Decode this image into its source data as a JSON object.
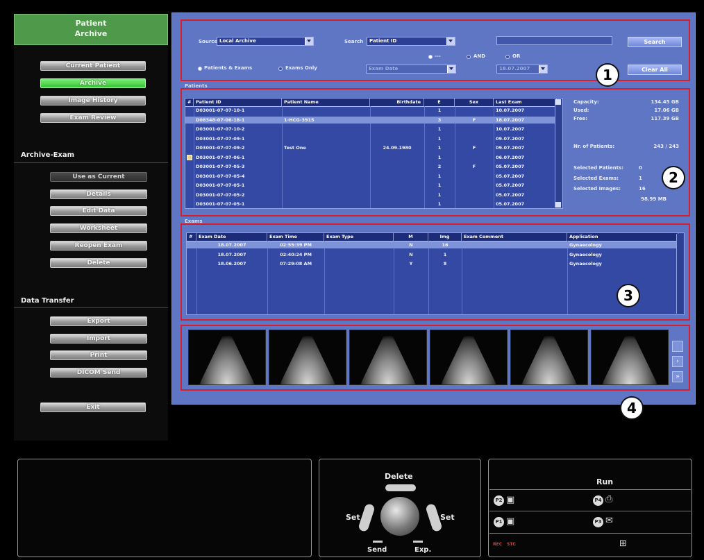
{
  "sidebar": {
    "title_line1": "Patient",
    "title_line2": "Archive",
    "top_buttons": [
      "Current Patient",
      "Archive",
      "Image History",
      "Exam Review"
    ],
    "archive_exam_heading": "Archive-Exam",
    "archive_exam_buttons": [
      "Use as Current",
      "Details",
      "Edit Data",
      "Worksheet",
      "Reopen Exam",
      "Delete"
    ],
    "data_transfer_heading": "Data Transfer",
    "data_transfer_buttons": [
      "Export",
      "Import",
      "Print",
      "DICOM Send"
    ],
    "exit_label": "Exit"
  },
  "search": {
    "source_label": "Source",
    "source_value": "Local Archive",
    "search_label": "Search",
    "search_field": "Patient ID",
    "search_input_value": "",
    "search_button": "Search",
    "radio_patients_exams": "Patients & Exams",
    "radio_exams_only": "Exams Only",
    "logic_none": "---",
    "logic_and": "AND",
    "logic_or": "OR",
    "date_field": "Exam Date",
    "date_value": "18.07.2007",
    "clear_button": "Clear All"
  },
  "patients": {
    "section_label": "Patients",
    "columns": [
      "#",
      "Patient ID",
      "Patient Name",
      "Birthdate",
      "E",
      "Sex",
      "Last Exam"
    ],
    "rows": [
      [
        "",
        "D03001-07-07-10-1",
        "",
        "",
        "1",
        "",
        "10.07.2007"
      ],
      [
        "",
        "D08348-07-06-18-1",
        "1-HCG-3915",
        "",
        "3",
        "F",
        "18.07.2007"
      ],
      [
        "",
        "D03001-07-07-10-2",
        "",
        "",
        "1",
        "",
        "10.07.2007"
      ],
      [
        "",
        "D03001-07-07-09-1",
        "",
        "",
        "1",
        "",
        "09.07.2007"
      ],
      [
        "",
        "D03001-07-07-09-2",
        "Test One",
        "24.09.1980",
        "1",
        "F",
        "09.07.2007"
      ],
      [
        "",
        "D03001-07-07-06-1",
        "",
        "",
        "1",
        "",
        "06.07.2007"
      ],
      [
        "",
        "D03001-07-07-05-3",
        "",
        "",
        "2",
        "F",
        "05.07.2007"
      ],
      [
        "",
        "D03001-07-07-05-4",
        "",
        "",
        "1",
        "",
        "05.07.2007"
      ],
      [
        "",
        "D03001-07-07-05-1",
        "",
        "",
        "1",
        "",
        "05.07.2007"
      ],
      [
        "",
        "D03001-07-07-05-2",
        "",
        "",
        "1",
        "",
        "05.07.2007"
      ],
      [
        "",
        "D03001-07-07-05-1",
        "",
        "",
        "1",
        "",
        "05.07.2007"
      ]
    ],
    "selected_row": 1,
    "marked_row": 5
  },
  "stats": {
    "capacity_label": "Capacity:",
    "capacity_value": "134.45 GB",
    "used_label": "Used:",
    "used_value": "17.06 GB",
    "free_label": "Free:",
    "free_value": "117.39 GB",
    "patients_label": "Nr. of Patients:",
    "patients_value": "243 / 243",
    "sel_patients_label": "Selected Patients:",
    "sel_patients_value": "0",
    "sel_exams_label": "Selected Exams:",
    "sel_exams_value": "1",
    "sel_images_label": "Selected Images:",
    "sel_images_value": "16",
    "size_value": "98.99 MB"
  },
  "exams": {
    "section_label": "Exams",
    "columns": [
      "#",
      "Exam Date",
      "Exam Time",
      "Exam Type",
      "M",
      "Img",
      "Exam Comment",
      "Application"
    ],
    "rows": [
      [
        "",
        "18.07.2007",
        "02:55:39 PM",
        "",
        "N",
        "16",
        "",
        "Gynaecology"
      ],
      [
        "",
        "18.07.2007",
        "02:40:24 PM",
        "",
        "N",
        "1",
        "",
        "Gynaecology"
      ],
      [
        "",
        "18.06.2007",
        "07:29:08 AM",
        "",
        "Y",
        "8",
        "",
        "Gynaecology"
      ]
    ],
    "selected_row": 0
  },
  "thumbnails": {
    "count": 6
  },
  "callouts": [
    "1",
    "2",
    "3",
    "4"
  ],
  "controls": {
    "delete_label": "Delete",
    "set_left": "Set",
    "set_right": "Set",
    "send_label": "Send",
    "exp_label": "Exp.",
    "run_label": "Run",
    "keys": [
      "P2",
      "P4",
      "P1",
      "P3"
    ],
    "rec_label": "REC",
    "stc_label": "STC"
  },
  "colors": {
    "panel_blue": "#5e76c4",
    "highlight_red": "#d61f2c",
    "active_green": "#35c332"
  }
}
